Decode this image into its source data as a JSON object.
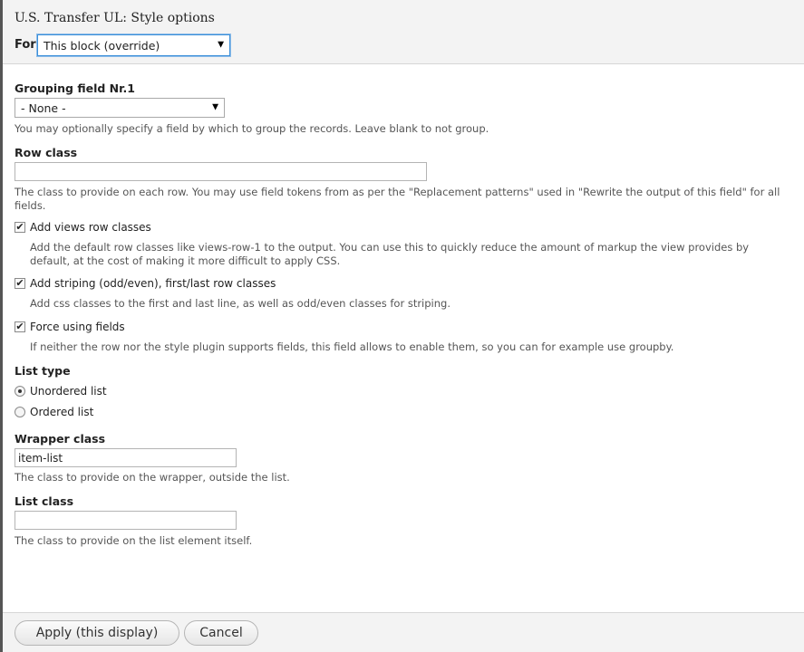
{
  "header": {
    "title": "U.S. Transfer UL: Style options",
    "for_label": "For",
    "for_selected": "This block (override)"
  },
  "form": {
    "grouping": {
      "label": "Grouping field Nr.1",
      "selected": "- None -",
      "description": "You may optionally specify a field by which to group the records. Leave blank to not group."
    },
    "row_class": {
      "label": "Row class",
      "value": "",
      "description_line1": "The class to provide on each row. You may use field tokens from as per the \"Replacement patterns\" used in \"Rewrite the output of this field\" for all",
      "description_line2": "fields."
    },
    "views_row_classes": {
      "label": "Add views row classes",
      "checked": true,
      "description_line1": "Add the default row classes like views-row-1 to the output. You can use this to quickly reduce the amount of markup the view provides by",
      "description_line2": "default, at the cost of making it more difficult to apply CSS."
    },
    "striping": {
      "label": "Add striping (odd/even), first/last row classes",
      "checked": true,
      "description": "Add css classes to the first and last line, as well as odd/even classes for striping."
    },
    "force_fields": {
      "label": "Force using fields",
      "checked": true,
      "description": "If neither the row nor the style plugin supports fields, this field allows to enable them, so you can for example use groupby."
    },
    "list_type": {
      "label": "List type",
      "options": [
        "Unordered list",
        "Ordered list"
      ],
      "selected": "Unordered list"
    },
    "wrapper_class": {
      "label": "Wrapper class",
      "value": "item-list",
      "description": "The class to provide on the wrapper, outside the list."
    },
    "list_class": {
      "label": "List class",
      "value": "",
      "description": "The class to provide on the list element itself."
    }
  },
  "footer": {
    "apply_label": "Apply (this display)",
    "cancel_label": "Cancel"
  },
  "icons": {
    "dropdown": "chevron-down-icon",
    "check": "checkmark-icon"
  }
}
